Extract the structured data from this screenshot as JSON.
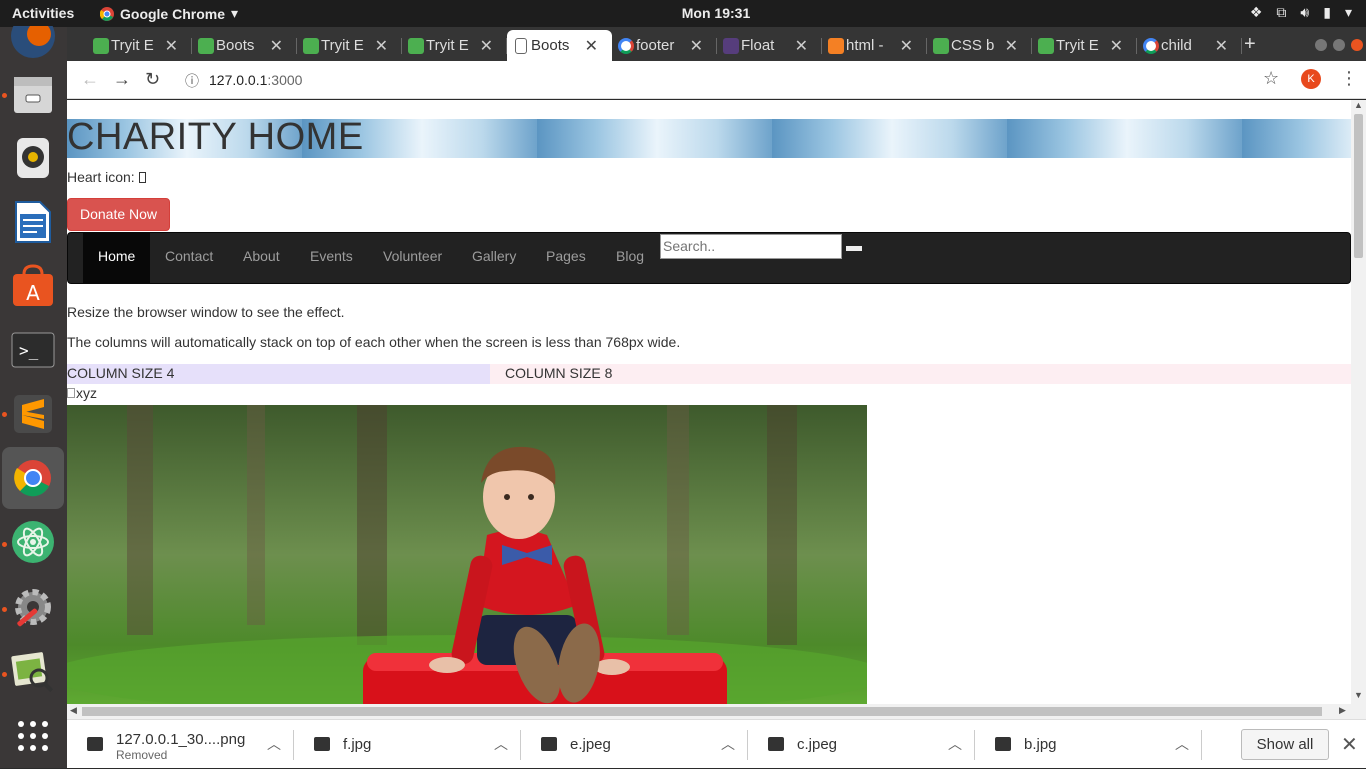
{
  "topbar": {
    "activities": "Activities",
    "app_name": "Google Chrome",
    "clock": "Mon 19:31"
  },
  "dock": {
    "items": [
      "firefox-icon",
      "files-icon",
      "rhythmbox-icon",
      "libreoffice-writer-icon",
      "software-center-icon",
      "terminal-icon",
      "sublime-text-icon",
      "chrome-icon",
      "atom-icon",
      "system-settings-icon",
      "image-viewer-icon",
      "app-grid-icon"
    ]
  },
  "tabs": [
    {
      "title": "Tryit E",
      "icon": "w3schools-icon",
      "color": "#4caf50",
      "active": false
    },
    {
      "title": "Boots",
      "icon": "w3schools-icon",
      "color": "#4caf50",
      "active": false
    },
    {
      "title": "Tryit E",
      "icon": "w3schools-icon",
      "color": "#4caf50",
      "active": false
    },
    {
      "title": "Tryit E",
      "icon": "w3schools-icon",
      "color": "#4caf50",
      "active": false
    },
    {
      "title": "Boots",
      "icon": "document-icon",
      "color": "#ffffff",
      "active": true
    },
    {
      "title": "footer",
      "icon": "google-icon",
      "color": "#ffffff",
      "active": false
    },
    {
      "title": "Float",
      "icon": "bootstrap-icon",
      "color": "#563d7c",
      "active": false
    },
    {
      "title": "html -",
      "icon": "stackoverflow-icon",
      "color": "#f48024",
      "active": false
    },
    {
      "title": "CSS b",
      "icon": "w3schools-icon",
      "color": "#4caf50",
      "active": false
    },
    {
      "title": "Tryit E",
      "icon": "w3schools-icon",
      "color": "#4caf50",
      "active": false
    },
    {
      "title": "child",
      "icon": "google-icon",
      "color": "#ffffff",
      "active": false
    }
  ],
  "address": {
    "host": "127.0.0.1",
    "port": ":3000",
    "avatar_letter": "K"
  },
  "page": {
    "heading": "CHARITY HOME",
    "heart_label": "Heart icon:",
    "donate": "Donate Now",
    "nav": [
      "Home",
      "Contact",
      "About",
      "Events",
      "Volunteer",
      "Gallery",
      "Pages",
      "Blog"
    ],
    "search_placeholder": "Search..",
    "para1": "Resize the browser window to see the effect.",
    "para2": "The columns will automatically stack on top of each other when the screen is less than 768px wide.",
    "col4": "COLUMN SIZE 4",
    "col8": "COLUMN SIZE 8",
    "img_alt": "xyz"
  },
  "downloads": {
    "items": [
      {
        "name": "127.0.0.1_30....png",
        "status": "Removed"
      },
      {
        "name": "f.jpg",
        "status": ""
      },
      {
        "name": "e.jpeg",
        "status": ""
      },
      {
        "name": "c.jpeg",
        "status": ""
      },
      {
        "name": "b.jpg",
        "status": ""
      }
    ],
    "show_all": "Show all"
  }
}
